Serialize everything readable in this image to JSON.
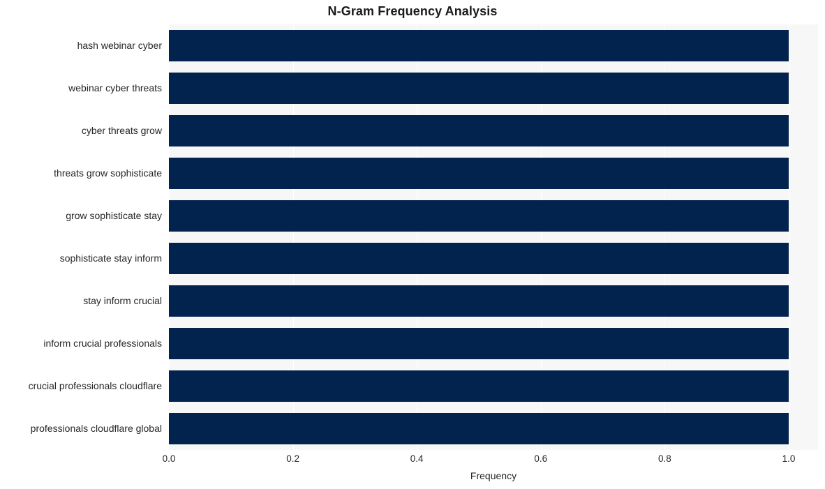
{
  "chart_data": {
    "type": "bar",
    "orientation": "horizontal",
    "title": "N-Gram Frequency Analysis",
    "xlabel": "Frequency",
    "ylabel": "",
    "categories": [
      "hash webinar cyber",
      "webinar cyber threats",
      "cyber threats grow",
      "threats grow sophisticate",
      "grow sophisticate stay",
      "sophisticate stay inform",
      "stay inform crucial",
      "inform crucial professionals",
      "crucial professionals cloudflare",
      "professionals cloudflare global"
    ],
    "values": [
      1.0,
      1.0,
      1.0,
      1.0,
      1.0,
      1.0,
      1.0,
      1.0,
      1.0,
      1.0
    ],
    "xlim": [
      0.0,
      1.0
    ],
    "xticks": [
      0.0,
      0.2,
      0.4,
      0.6,
      0.8,
      1.0
    ],
    "xtick_labels": [
      "0.0",
      "0.2",
      "0.4",
      "0.6",
      "0.8",
      "1.0"
    ],
    "grid": true,
    "grid_axis": "x",
    "grid_color": "#ffffff",
    "legend": null,
    "bar_color": "#02234d",
    "plot_background": "#f7f7f7",
    "figure_background": "#ffffff"
  }
}
